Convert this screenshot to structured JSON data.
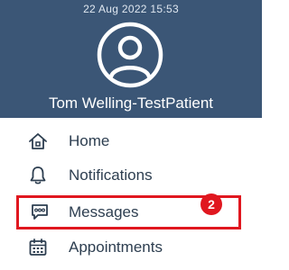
{
  "status_bar": {
    "timestamp": "22 Aug 2022 15:53"
  },
  "profile": {
    "name": "Tom Welling-TestPatient",
    "avatar_icon": "user-circle-icon"
  },
  "menu": {
    "items": [
      {
        "label": "Home",
        "icon": "home-icon"
      },
      {
        "label": "Notifications",
        "icon": "bell-icon"
      },
      {
        "label": "Messages",
        "icon": "chat-bubble-icon",
        "badge": "2",
        "highlighted": true
      },
      {
        "label": "Appointments",
        "icon": "calendar-icon"
      }
    ]
  },
  "colors": {
    "header_bg": "#3b5676",
    "highlight_border": "#e0171f",
    "badge_bg": "#e0171f",
    "text": "#2d3e50"
  }
}
